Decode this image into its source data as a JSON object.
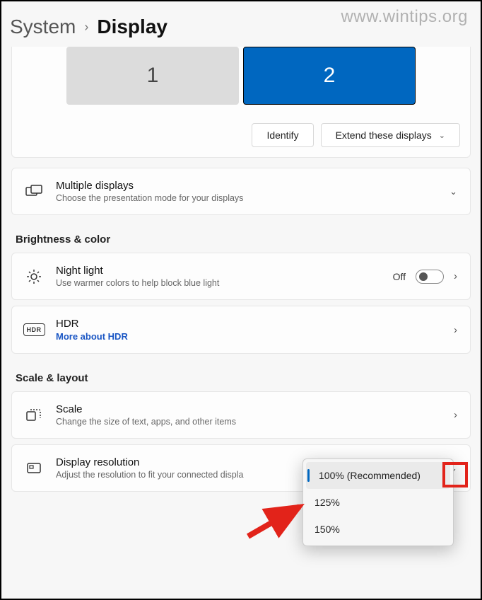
{
  "watermark": "www.wintips.org",
  "breadcrumb": {
    "parent": "System",
    "current": "Display"
  },
  "monitors": {
    "m1": "1",
    "m2": "2"
  },
  "actions": {
    "identify": "Identify",
    "extend": "Extend these displays"
  },
  "multiple": {
    "title": "Multiple displays",
    "sub": "Choose the presentation mode for your displays"
  },
  "sections": {
    "brightness": "Brightness & color",
    "scale": "Scale & layout"
  },
  "night": {
    "title": "Night light",
    "sub": "Use warmer colors to help block blue light",
    "state": "Off"
  },
  "hdr": {
    "title": "HDR",
    "link": "More about HDR",
    "badge": "HDR"
  },
  "scale": {
    "title": "Scale",
    "sub": "Change the size of text, apps, and other items"
  },
  "resolution": {
    "title": "Display resolution",
    "sub": "Adjust the resolution to fit your connected displa"
  },
  "scale_options": {
    "o1": "100% (Recommended)",
    "o2": "125%",
    "o3": "150%"
  }
}
